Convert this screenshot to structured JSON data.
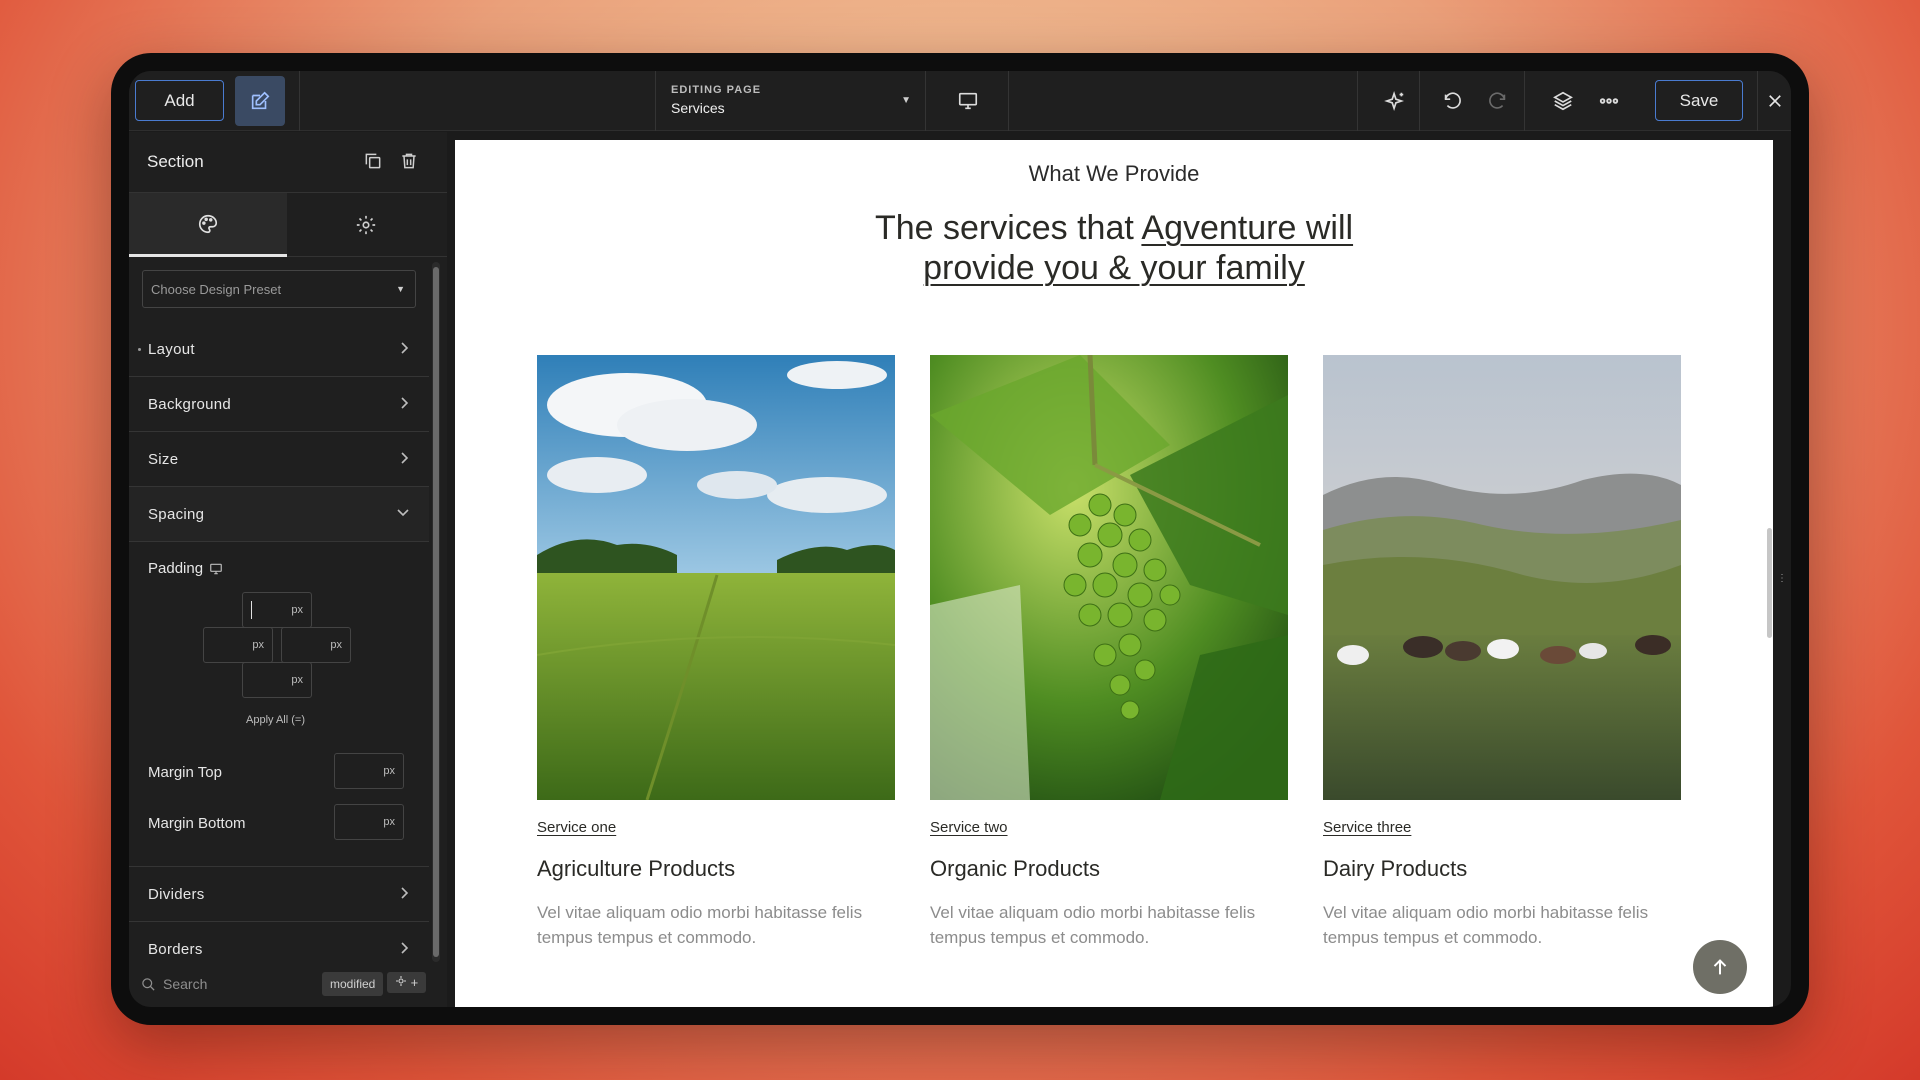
{
  "topbar": {
    "add_label": "Add",
    "editing_label": "EDITING PAGE",
    "editing_value": "Services",
    "save_label": "Save"
  },
  "sidebar": {
    "title": "Section",
    "preset_placeholder": "Choose Design Preset",
    "accordions": {
      "layout": "Layout",
      "background": "Background",
      "size": "Size",
      "spacing": "Spacing",
      "dividers": "Dividers",
      "borders": "Borders"
    },
    "padding_label": "Padding",
    "unit": "px",
    "apply_all": "Apply All (=)",
    "margin_top": "Margin Top",
    "margin_bottom": "Margin Bottom",
    "search_placeholder": "Search",
    "modified_badge": "modified",
    "filter_add": "+"
  },
  "page": {
    "kicker": "What We Provide",
    "headline_plain": "The services that ",
    "headline_underlined_1": "Agventure will",
    "headline_underlined_2": "provide you & your family",
    "cards": [
      {
        "link": "Service one",
        "title": "Agriculture Products",
        "desc": "Vel vitae aliquam odio morbi habitasse felis tempus tempus et commodo."
      },
      {
        "link": "Service two",
        "title": "Organic Products",
        "desc": "Vel vitae aliquam odio morbi habitasse felis tempus tempus et commodo."
      },
      {
        "link": "Service three",
        "title": "Dairy Products",
        "desc": "Vel vitae aliquam odio morbi habitasse felis tempus tempus et commodo."
      }
    ]
  },
  "colors": {
    "accent": "#4a7bd0",
    "panel": "#1f1f1f",
    "heading": "#2a2a26",
    "muted": "#8c8c8c"
  }
}
